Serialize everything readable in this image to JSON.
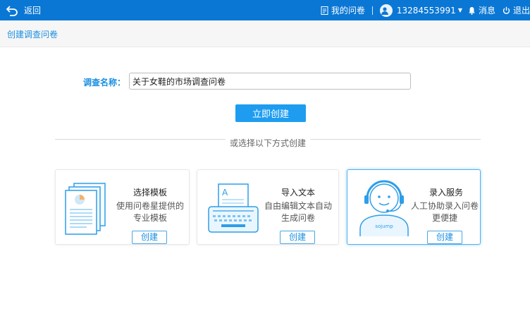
{
  "topbar": {
    "back_label": "返回",
    "my_surveys_label": "我的问卷",
    "phone": "13284553991",
    "messages_label": "消息",
    "logout_label": "退出"
  },
  "breadcrumb": {
    "label": "创建调查问卷"
  },
  "form": {
    "name_label": "调查名称：",
    "name_value": "关于女鞋的市场调查问卷",
    "create_button": "立即创建"
  },
  "divider_text": "或选择以下方式创建",
  "cards": [
    {
      "title": "选择模板",
      "desc_line1": "使用问卷星提供的",
      "desc_line2": "专业模板",
      "button": "创建",
      "icon": "template-documents-icon"
    },
    {
      "title": "导入文本",
      "desc_line1": "自由编辑文本自动",
      "desc_line2": "生成问卷",
      "button": "创建",
      "icon": "typewriter-icon"
    },
    {
      "title": "录入服务",
      "desc_line1": "人工协助录入问卷",
      "desc_line2": "更便捷",
      "button": "创建",
      "icon": "headset-agent-icon",
      "badge": "sojump"
    }
  ],
  "colors": {
    "topbar": "#0a77d5",
    "accent": "#1e9df0",
    "link": "#1a8fe0"
  }
}
